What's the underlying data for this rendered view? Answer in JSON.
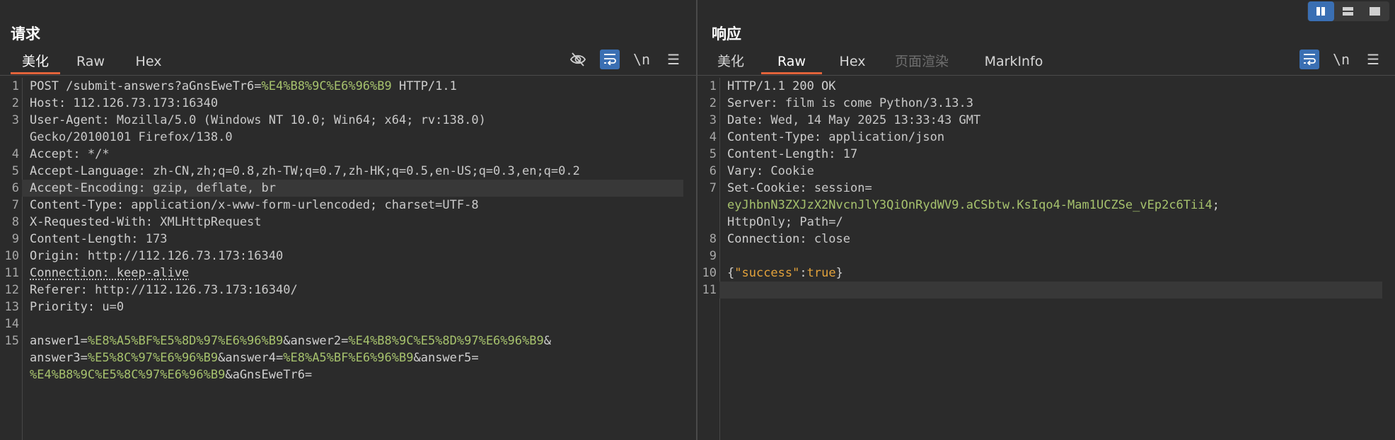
{
  "layout_switch": {
    "icons": [
      "split-vertical-icon",
      "split-horizontal-icon",
      "single-pane-icon"
    ],
    "selected": "split-vertical-icon"
  },
  "request": {
    "title": "请求",
    "tabs": [
      {
        "label": "美化",
        "active": true
      },
      {
        "label": "Raw",
        "active": false
      },
      {
        "label": "Hex",
        "active": false
      }
    ],
    "tools": {
      "newline": "\\n"
    },
    "lines": [
      {
        "n": "1",
        "parts": [
          [
            "k",
            "POST /submit-answers?aGnsEweTr6="
          ],
          [
            "g",
            "%E4%B8%9C%E6%96%B9"
          ],
          [
            "k",
            " HTTP/1.1"
          ]
        ]
      },
      {
        "n": "2",
        "parts": [
          [
            "k",
            "Host: "
          ],
          [
            "v",
            "112.126.73.173:16340"
          ]
        ]
      },
      {
        "n": "3",
        "parts": [
          [
            "k",
            "User-Agent: "
          ],
          [
            "v",
            "Mozilla/5.0 (Windows NT 10.0; Win64; x64; rv:138.0)"
          ]
        ]
      },
      {
        "n": "",
        "parts": [
          [
            "v",
            "Gecko/20100101 Firefox/138.0"
          ]
        ]
      },
      {
        "n": "4",
        "parts": [
          [
            "k",
            "Accept: "
          ],
          [
            "v",
            "*/*"
          ]
        ]
      },
      {
        "n": "5",
        "parts": [
          [
            "k",
            "Accept-Language: "
          ],
          [
            "v",
            "zh-CN,zh;q=0.8,zh-TW;q=0.7,zh-HK;q=0.5,en-US;q=0.3,en;q=0.2"
          ]
        ]
      },
      {
        "n": "6",
        "parts": [
          [
            "k",
            "Accept-Encoding: "
          ],
          [
            "v",
            "gzip, deflate, br"
          ]
        ],
        "highlight": true
      },
      {
        "n": "7",
        "parts": [
          [
            "k",
            "Content-Type: "
          ],
          [
            "v",
            "application/x-www-form-urlencoded; charset=UTF-8"
          ]
        ]
      },
      {
        "n": "8",
        "parts": [
          [
            "k",
            "X-Requested-With: "
          ],
          [
            "v",
            "XMLHttpRequest"
          ]
        ]
      },
      {
        "n": "9",
        "parts": [
          [
            "k",
            "Content-Length: "
          ],
          [
            "v",
            "173"
          ]
        ]
      },
      {
        "n": "10",
        "parts": [
          [
            "k",
            "Origin: "
          ],
          [
            "v",
            "http://112.126.73.173:16340"
          ]
        ]
      },
      {
        "n": "11",
        "parts": [
          [
            "d",
            "Connection: keep-alive"
          ]
        ]
      },
      {
        "n": "12",
        "parts": [
          [
            "k",
            "Referer: "
          ],
          [
            "v",
            "http://112.126.73.173:16340/"
          ]
        ]
      },
      {
        "n": "13",
        "parts": [
          [
            "k",
            "Priority: "
          ],
          [
            "v",
            "u=0"
          ]
        ]
      },
      {
        "n": "14",
        "parts": []
      },
      {
        "n": "15",
        "parts": [
          [
            "k",
            "answer1="
          ],
          [
            "g",
            "%E8%A5%BF%E5%8D%97%E6%96%B9"
          ],
          [
            "k",
            "&answer2="
          ],
          [
            "g",
            "%E4%B8%9C%E5%8D%97%E6%96%B9"
          ],
          [
            "k",
            "&"
          ]
        ]
      },
      {
        "n": "",
        "parts": [
          [
            "k",
            "answer3="
          ],
          [
            "g",
            "%E5%8C%97%E6%96%B9"
          ],
          [
            "k",
            "&answer4="
          ],
          [
            "g",
            "%E8%A5%BF%E6%96%B9"
          ],
          [
            "k",
            "&answer5="
          ]
        ]
      },
      {
        "n": "",
        "parts": [
          [
            "g",
            "%E4%B8%9C%E5%8C%97%E6%96%B9"
          ],
          [
            "k",
            "&aGnsEweTr6="
          ]
        ]
      }
    ]
  },
  "response": {
    "title": "响应",
    "tabs": [
      {
        "label": "美化",
        "active": false
      },
      {
        "label": "Raw",
        "active": true
      },
      {
        "label": "Hex",
        "active": false
      },
      {
        "label": "页面渲染",
        "active": false,
        "disabled": true
      },
      {
        "label": "MarkInfo",
        "active": false
      }
    ],
    "tools": {
      "newline": "\\n"
    },
    "lines": [
      {
        "n": "1",
        "parts": [
          [
            "k",
            "HTTP/1.1 200 OK"
          ]
        ]
      },
      {
        "n": "2",
        "parts": [
          [
            "k",
            "Server: "
          ],
          [
            "v",
            "film is come Python/3.13.3"
          ]
        ]
      },
      {
        "n": "3",
        "parts": [
          [
            "k",
            "Date: "
          ],
          [
            "v",
            "Wed, 14 May 2025 13:33:43 GMT"
          ]
        ]
      },
      {
        "n": "4",
        "parts": [
          [
            "k",
            "Content-Type: "
          ],
          [
            "v",
            "application/json"
          ]
        ]
      },
      {
        "n": "5",
        "parts": [
          [
            "k",
            "Content-Length: "
          ],
          [
            "v",
            "17"
          ]
        ]
      },
      {
        "n": "6",
        "parts": [
          [
            "k",
            "Vary: "
          ],
          [
            "v",
            "Cookie"
          ]
        ]
      },
      {
        "n": "7",
        "parts": [
          [
            "k",
            "Set-Cookie: "
          ],
          [
            "v",
            "session="
          ]
        ]
      },
      {
        "n": "",
        "parts": [
          [
            "g",
            "eyJhbnN3ZXJzX2NvcnJlY3QiOnRydWV9.aCSbtw.KsIqo4-Mam1UCZSe_vEp2c6Tii4"
          ],
          [
            "k",
            ";"
          ]
        ]
      },
      {
        "n": "",
        "parts": [
          [
            "v",
            "HttpOnly; Path=/"
          ]
        ]
      },
      {
        "n": "8",
        "parts": [
          [
            "k",
            "Connection: "
          ],
          [
            "v",
            "close"
          ]
        ]
      },
      {
        "n": "9",
        "parts": []
      },
      {
        "n": "10",
        "parts": [
          [
            "k",
            "{"
          ],
          [
            "o",
            "\"success\""
          ],
          [
            "k",
            ":"
          ],
          [
            "o",
            "true"
          ],
          [
            "k",
            "}"
          ]
        ]
      },
      {
        "n": "11",
        "parts": [],
        "highlight": true
      }
    ]
  }
}
